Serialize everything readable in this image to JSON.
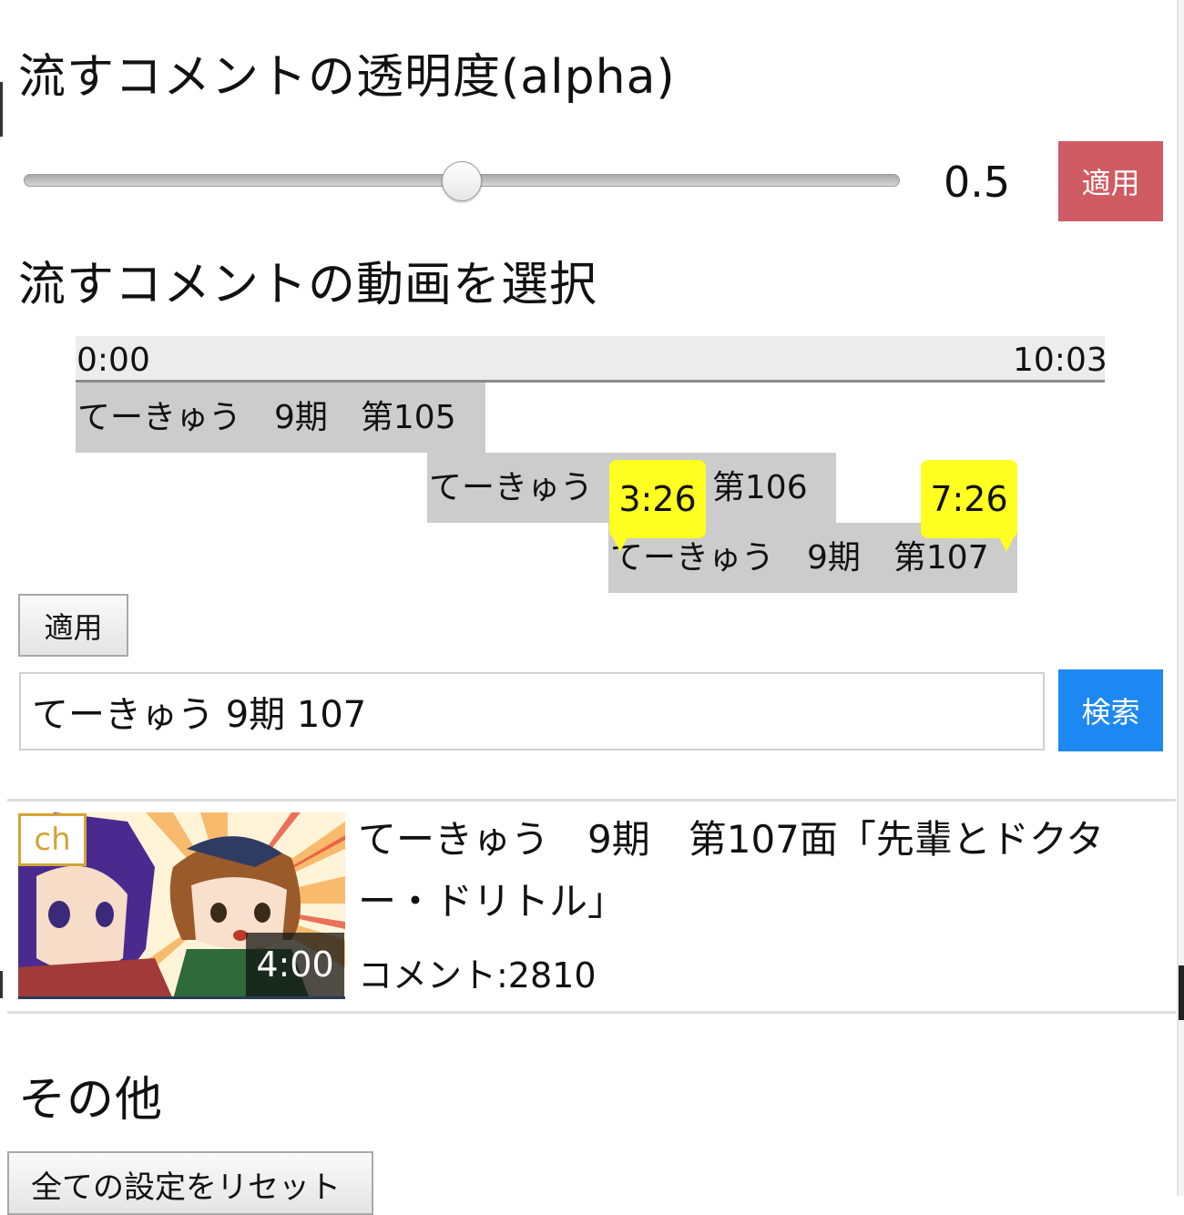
{
  "alpha": {
    "heading": "流すコメントの透明度(alpha)",
    "value_label": "0.5",
    "value": 0.5,
    "apply_label": "適用"
  },
  "video_select": {
    "heading": "流すコメントの動画を選択",
    "timeline": {
      "start": "0:00",
      "end": "10:03",
      "rows": [
        {
          "label": "てーきゅう　9期　第105"
        },
        {
          "label": "てーきゅう　9期　第106"
        },
        {
          "label": "てーきゅう　9期　第107"
        }
      ],
      "markers": [
        {
          "label": "3:26"
        },
        {
          "label": "7:26"
        }
      ]
    },
    "apply_label": "適用"
  },
  "search": {
    "value": "てーきゅう 9期 107",
    "button_label": "検索"
  },
  "result": {
    "badge": "ch",
    "duration": "4:00",
    "title": "てーきゅう　9期　第107面「先輩とドクター・ドリトル」",
    "comments": "コメント:2810"
  },
  "other": {
    "heading": "その他",
    "reset_label": "全ての設定をリセット"
  },
  "colors": {
    "apply_red": "#cf5c63",
    "search_blue": "#1e88f2",
    "marker_yellow": "#ffff22",
    "badge_gold": "#d4a437"
  }
}
